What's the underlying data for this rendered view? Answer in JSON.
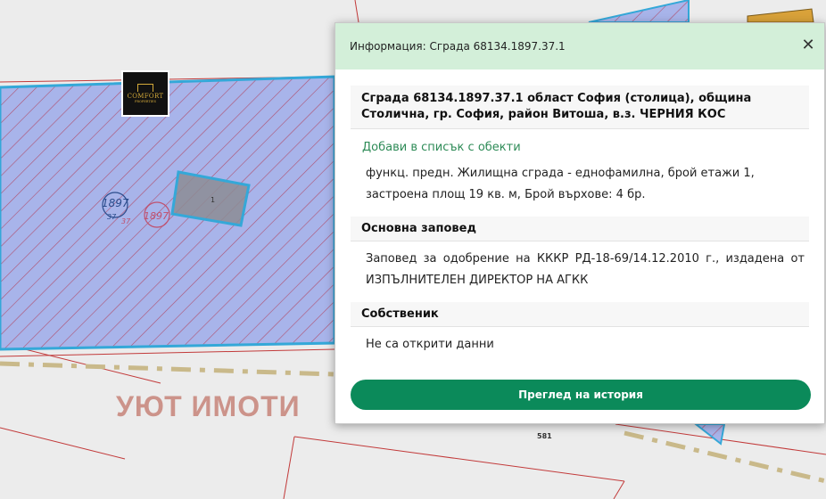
{
  "map": {
    "parcel_label": "1897",
    "parcel_sub": "37",
    "parcel_label_2": "1897",
    "parcel_sub_2": "37",
    "building_label": "1",
    "road_label": "581",
    "logo_brand": "COMFORT",
    "logo_sub": "PROPERTIES",
    "watermark": "УЮТ ИМОТИ",
    "colors": {
      "parcel_fill": "#a8b4ea",
      "parcel_stroke": "#34a8d8",
      "hatch": "#b05070",
      "building_fill": "#8c8c94",
      "road_line": "#c9b98a",
      "boundary": "#c23a3a"
    }
  },
  "popup": {
    "title": "Информация: Сграда 68134.1897.37.1",
    "close_icon": "close-icon",
    "building_heading": "Сграда 68134.1897.37.1 област София (столица), община Столична, гр. София, район Витоша, в.з. ЧЕРНИЯ КОС",
    "add_link": "Добави в списък с обекти",
    "description": "функц. предн. Жилищна сграда - еднофамилна, брой етажи 1, застроена площ 19 кв. м, Брой върхове: 4 бр.",
    "order_heading": "Основна заповед",
    "order_text": "Заповед за одобрение на КККР РД-18-69/14.12.2010 г., издадена от ИЗПЪЛНИТЕЛЕН ДИРЕКТОР НА АГКК",
    "owner_heading": "Собственик",
    "owner_text": "Не са открити данни",
    "history_button": "Преглед на история"
  }
}
